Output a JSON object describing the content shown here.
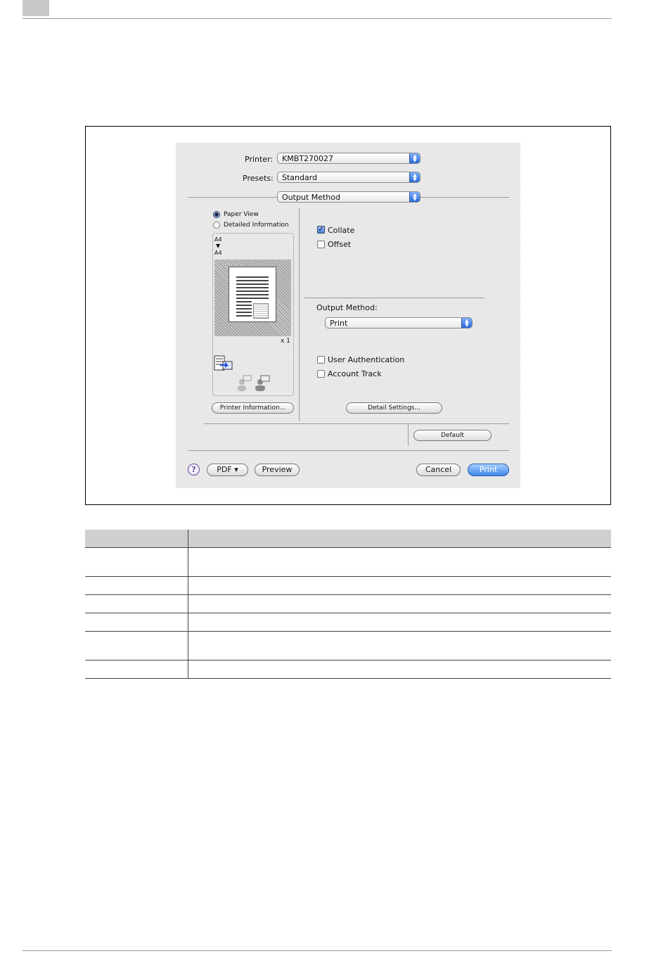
{
  "dialog": {
    "printer_label": "Printer:",
    "printer_value": "KMBT270027",
    "presets_label": "Presets:",
    "presets_value": "Standard",
    "pane_value": "Output Method",
    "paper_view": "Paper View",
    "detailed_information": "Detailed Information",
    "paper_size_top": "A4",
    "paper_size_bottom": "A4",
    "copies": "x 1",
    "collate": "Collate",
    "offset": "Offset",
    "output_method_label": "Output Method:",
    "output_method_value": "Print",
    "user_authentication": "User Authentication",
    "account_track": "Account Track",
    "printer_information_button": "Printer Information...",
    "detail_settings_button": "Detail Settings...",
    "default_button": "Default",
    "help_glyph": "?",
    "pdf_button": "PDF ▾",
    "preview_button": "Preview",
    "cancel_button": "Cancel",
    "print_button": "Print"
  },
  "colors": {
    "accent": "#3f86ea",
    "dialog_bg": "#e6e6e6",
    "table_header": "#cfcfcf"
  },
  "table": {
    "rows": 6
  }
}
